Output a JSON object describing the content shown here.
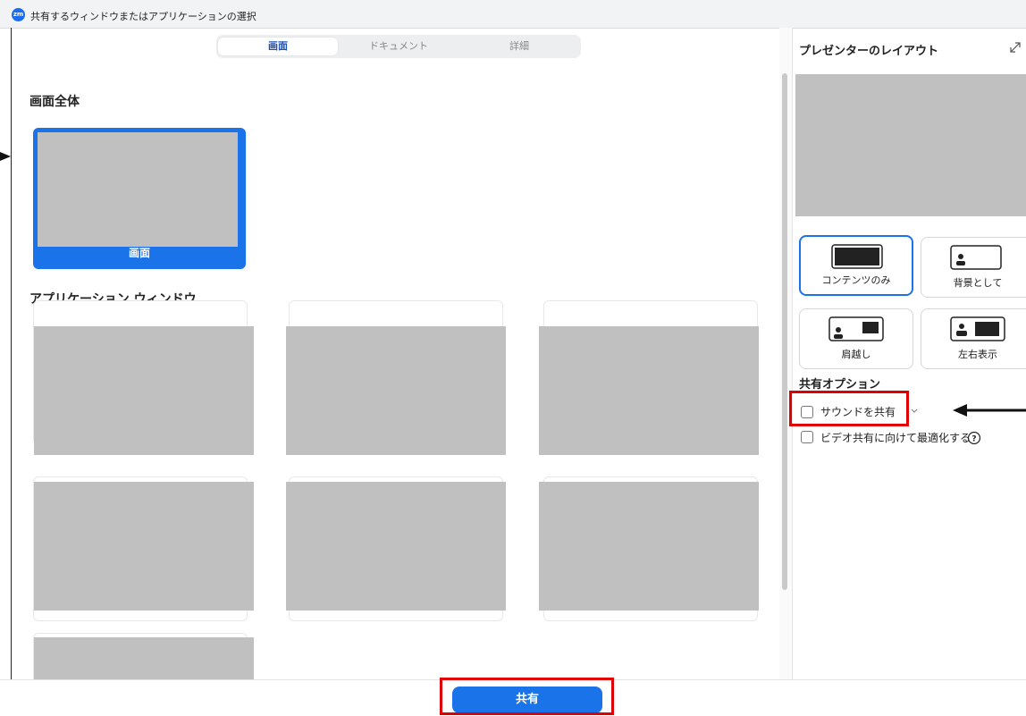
{
  "window": {
    "title": "共有するウィンドウまたはアプリケーションの選択",
    "logo_text": "zm"
  },
  "tabs": [
    {
      "label": "画面",
      "active": true
    },
    {
      "label": "ドキュメント",
      "active": false
    },
    {
      "label": "詳細",
      "active": false
    }
  ],
  "screen_section": {
    "title": "画面全体",
    "item_label": "画面"
  },
  "app_section": {
    "title": "アプリケーション ウィンドウ"
  },
  "right_panel": {
    "heading": "プレゼンターのレイアウト",
    "layouts": [
      {
        "label": "コンテンツのみ",
        "selected": true
      },
      {
        "label": "背景として",
        "selected": false
      },
      {
        "label": "肩越し",
        "selected": false
      },
      {
        "label": "左右表示",
        "selected": false
      }
    ],
    "options_title": "共有オプション",
    "options": [
      {
        "label": "サウンドを共有",
        "checked": false
      },
      {
        "label": "ビデオ共有に向けて最適化する",
        "checked": false
      }
    ]
  },
  "share_button": "共有",
  "colors": {
    "accent": "#1a73e8",
    "highlight": "#e00000",
    "placeholder": "#c0c0c0"
  }
}
